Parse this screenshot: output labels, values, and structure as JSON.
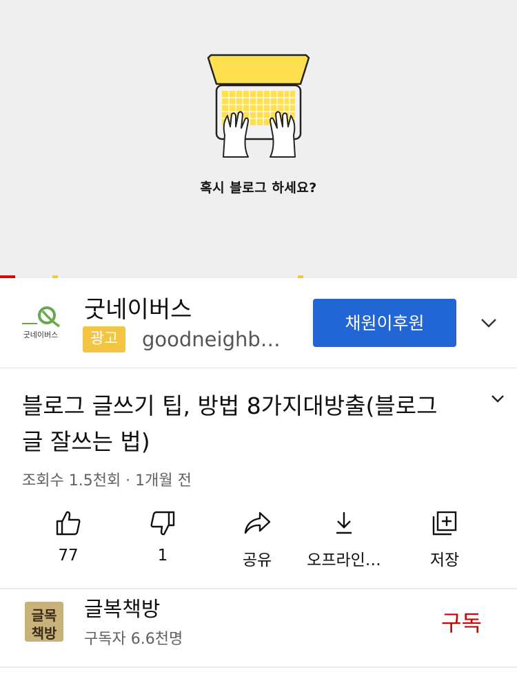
{
  "video": {
    "caption": "혹시 블로그 하세요?"
  },
  "ad": {
    "logo_text": "굿네이버스",
    "title": "굿네이버스",
    "badge": "광고",
    "url": "goodneighb…",
    "cta_label": "채원이후원",
    "colors": {
      "cta": "#2265d4",
      "badge": "#f4c542"
    }
  },
  "video_info": {
    "title": "블로그 글쓰기 팁, 방법 8가지대방출(블로그 글 잘쓰는 법)",
    "meta": "조회수 1.5천회 · 1개월 전"
  },
  "actions": [
    {
      "icon": "thumbs-up-icon",
      "label": "77"
    },
    {
      "icon": "thumbs-down-icon",
      "label": "1"
    },
    {
      "icon": "share-icon",
      "label": "공유"
    },
    {
      "icon": "download-icon",
      "label": "오프라인…"
    },
    {
      "icon": "save-playlist-icon",
      "label": "저장"
    }
  ],
  "channel": {
    "avatar_text": [
      "글목",
      "책방"
    ],
    "name": "글복책방",
    "subscribers": "구독자 6.6천명",
    "subscribe_label": "구독",
    "subscribe_color": "#cc0000"
  }
}
